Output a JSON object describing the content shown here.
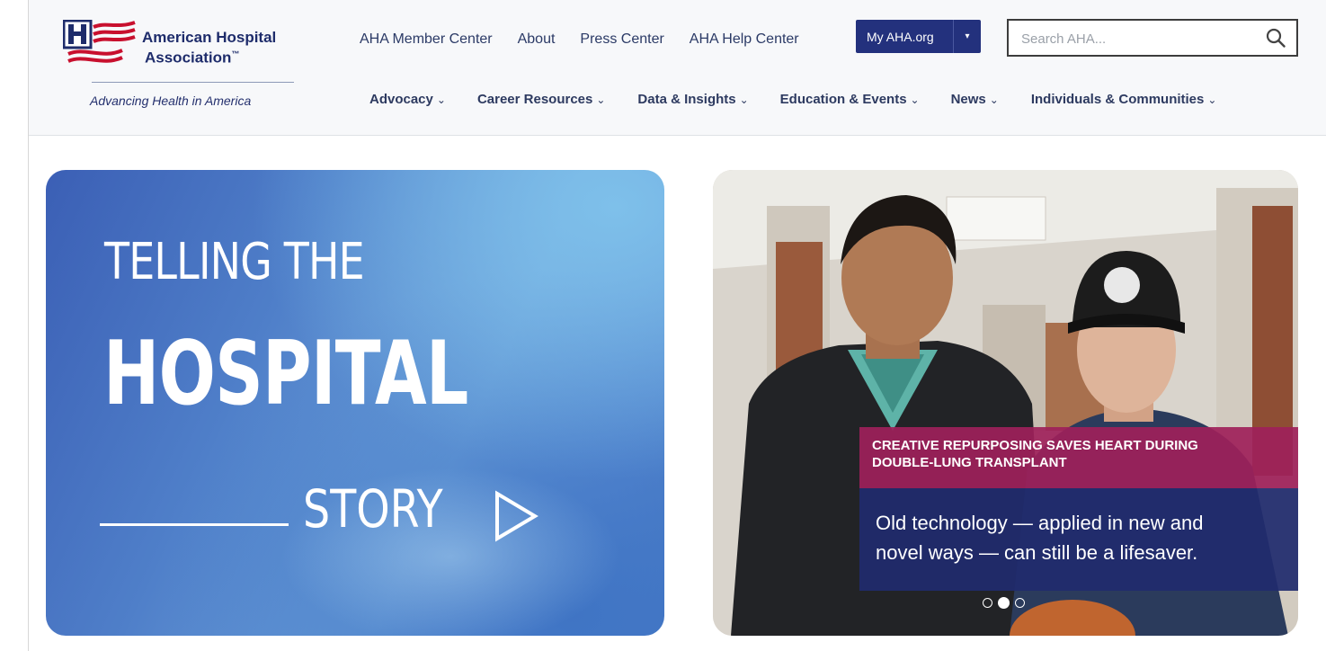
{
  "brand": {
    "name_line1": "American Hospital",
    "name_line2": "Association",
    "trademark": "™",
    "tagline": "Advancing Health in America",
    "colors": {
      "navy": "#1e2c6b",
      "red": "#c8102e"
    }
  },
  "utility_nav": [
    {
      "label": "AHA Member Center"
    },
    {
      "label": "About"
    },
    {
      "label": "Press Center"
    },
    {
      "label": "AHA Help Center"
    }
  ],
  "my_aha": {
    "label": "My AHA.org",
    "caret": "▾"
  },
  "search": {
    "placeholder": "Search AHA...",
    "value": "",
    "icon": "search-icon"
  },
  "main_nav": [
    {
      "label": "Advocacy"
    },
    {
      "label": "Career Resources"
    },
    {
      "label": "Data & Insights"
    },
    {
      "label": "Education & Events"
    },
    {
      "label": "News"
    },
    {
      "label": "Individuals & Communities"
    }
  ],
  "promo": {
    "line1": "TELLING THE",
    "line2": "HOSPITAL",
    "line3": "STORY"
  },
  "carousel": {
    "headline_line1": "CREATIVE REPURPOSING SAVES HEART DURING",
    "headline_line2": "DOUBLE-LUNG TRANSPLANT",
    "body_line1": "Old technology — applied in new and",
    "body_line2": "novel ways — can still be a lifesaver.",
    "slide_count": 3,
    "active_slide": 2,
    "colors": {
      "headline_bg": "#9e215a",
      "body_bg": "#202b6e"
    }
  }
}
